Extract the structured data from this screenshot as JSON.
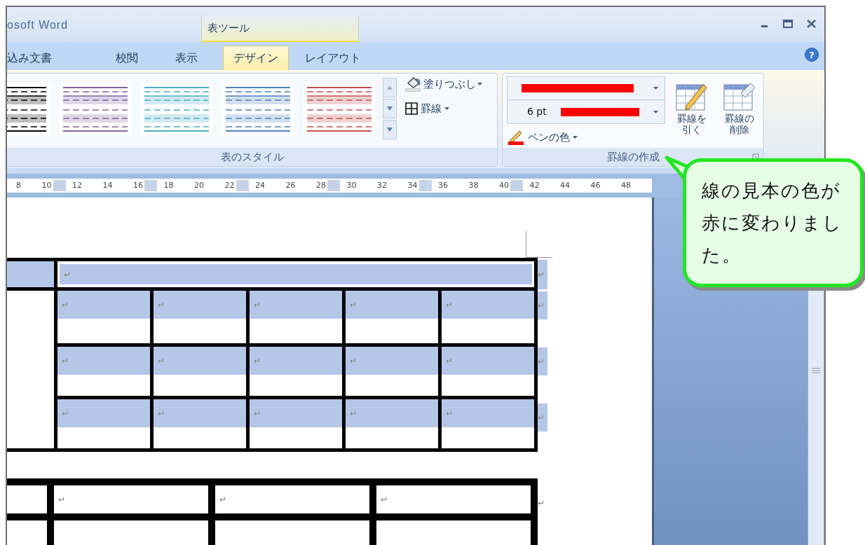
{
  "window": {
    "title": "osoft Word",
    "contextual_header": "表ツール"
  },
  "tabs": [
    {
      "label": "込み文書",
      "selected": false
    },
    {
      "label": "校閲",
      "selected": false
    },
    {
      "label": "表示",
      "selected": false
    },
    {
      "label": "デザイン",
      "selected": true
    },
    {
      "label": "レイアウト",
      "selected": false
    }
  ],
  "help": "?",
  "ribbon": {
    "style_group": {
      "label": "表のスタイル",
      "shading": "塗りつぶし",
      "borders": "罫線"
    },
    "border_group": {
      "label": "罫線の作成",
      "weight": "6 pt",
      "pen_color_button": "ペンの色",
      "draw_table": [
        "罫線を",
        "引く"
      ],
      "eraser": [
        "罫線の",
        "削除"
      ]
    }
  },
  "ruler": [
    {
      "label": "8",
      "column_marker": false
    },
    {
      "label": "10",
      "column_marker": true
    },
    {
      "label": "12",
      "column_marker": false
    },
    {
      "label": "14",
      "column_marker": false
    },
    {
      "label": "16",
      "column_marker": true
    },
    {
      "label": "18",
      "column_marker": false
    },
    {
      "label": "20",
      "column_marker": false
    },
    {
      "label": "22",
      "column_marker": true
    },
    {
      "label": "24",
      "column_marker": false
    },
    {
      "label": "26",
      "column_marker": false
    },
    {
      "label": "28",
      "column_marker": true
    },
    {
      "label": "30",
      "column_marker": false
    },
    {
      "label": "32",
      "column_marker": false
    },
    {
      "label": "34",
      "column_marker": true
    },
    {
      "label": "36",
      "column_marker": false
    },
    {
      "label": "38",
      "column_marker": false
    },
    {
      "label": "40",
      "column_marker": true
    },
    {
      "label": "42",
      "column_marker": false
    },
    {
      "label": "44",
      "column_marker": false
    },
    {
      "label": "46",
      "column_marker": false
    },
    {
      "label": "48",
      "column_marker": false
    }
  ],
  "table_1": {
    "selected": true,
    "top_row": {
      "cell": "↵",
      "end_mark": "↵"
    },
    "rows": [
      {
        "cells": [
          "↵",
          "↵",
          "↵",
          "↵",
          "↵"
        ],
        "end_mark": "↵"
      },
      {
        "cells": [
          "↵",
          "↵",
          "↵",
          "↵",
          "↵"
        ],
        "end_mark": "↵"
      },
      {
        "cells": [
          "↵",
          "↵",
          "↵",
          "↵",
          "↵"
        ],
        "end_mark": "↵"
      }
    ]
  },
  "table_2": {
    "rows": [
      {
        "cells": [
          "↵",
          "↵",
          "↵"
        ],
        "end_mark": "↵"
      }
    ]
  },
  "callout": {
    "text": "線の見本の色が赤に変わりました。"
  }
}
